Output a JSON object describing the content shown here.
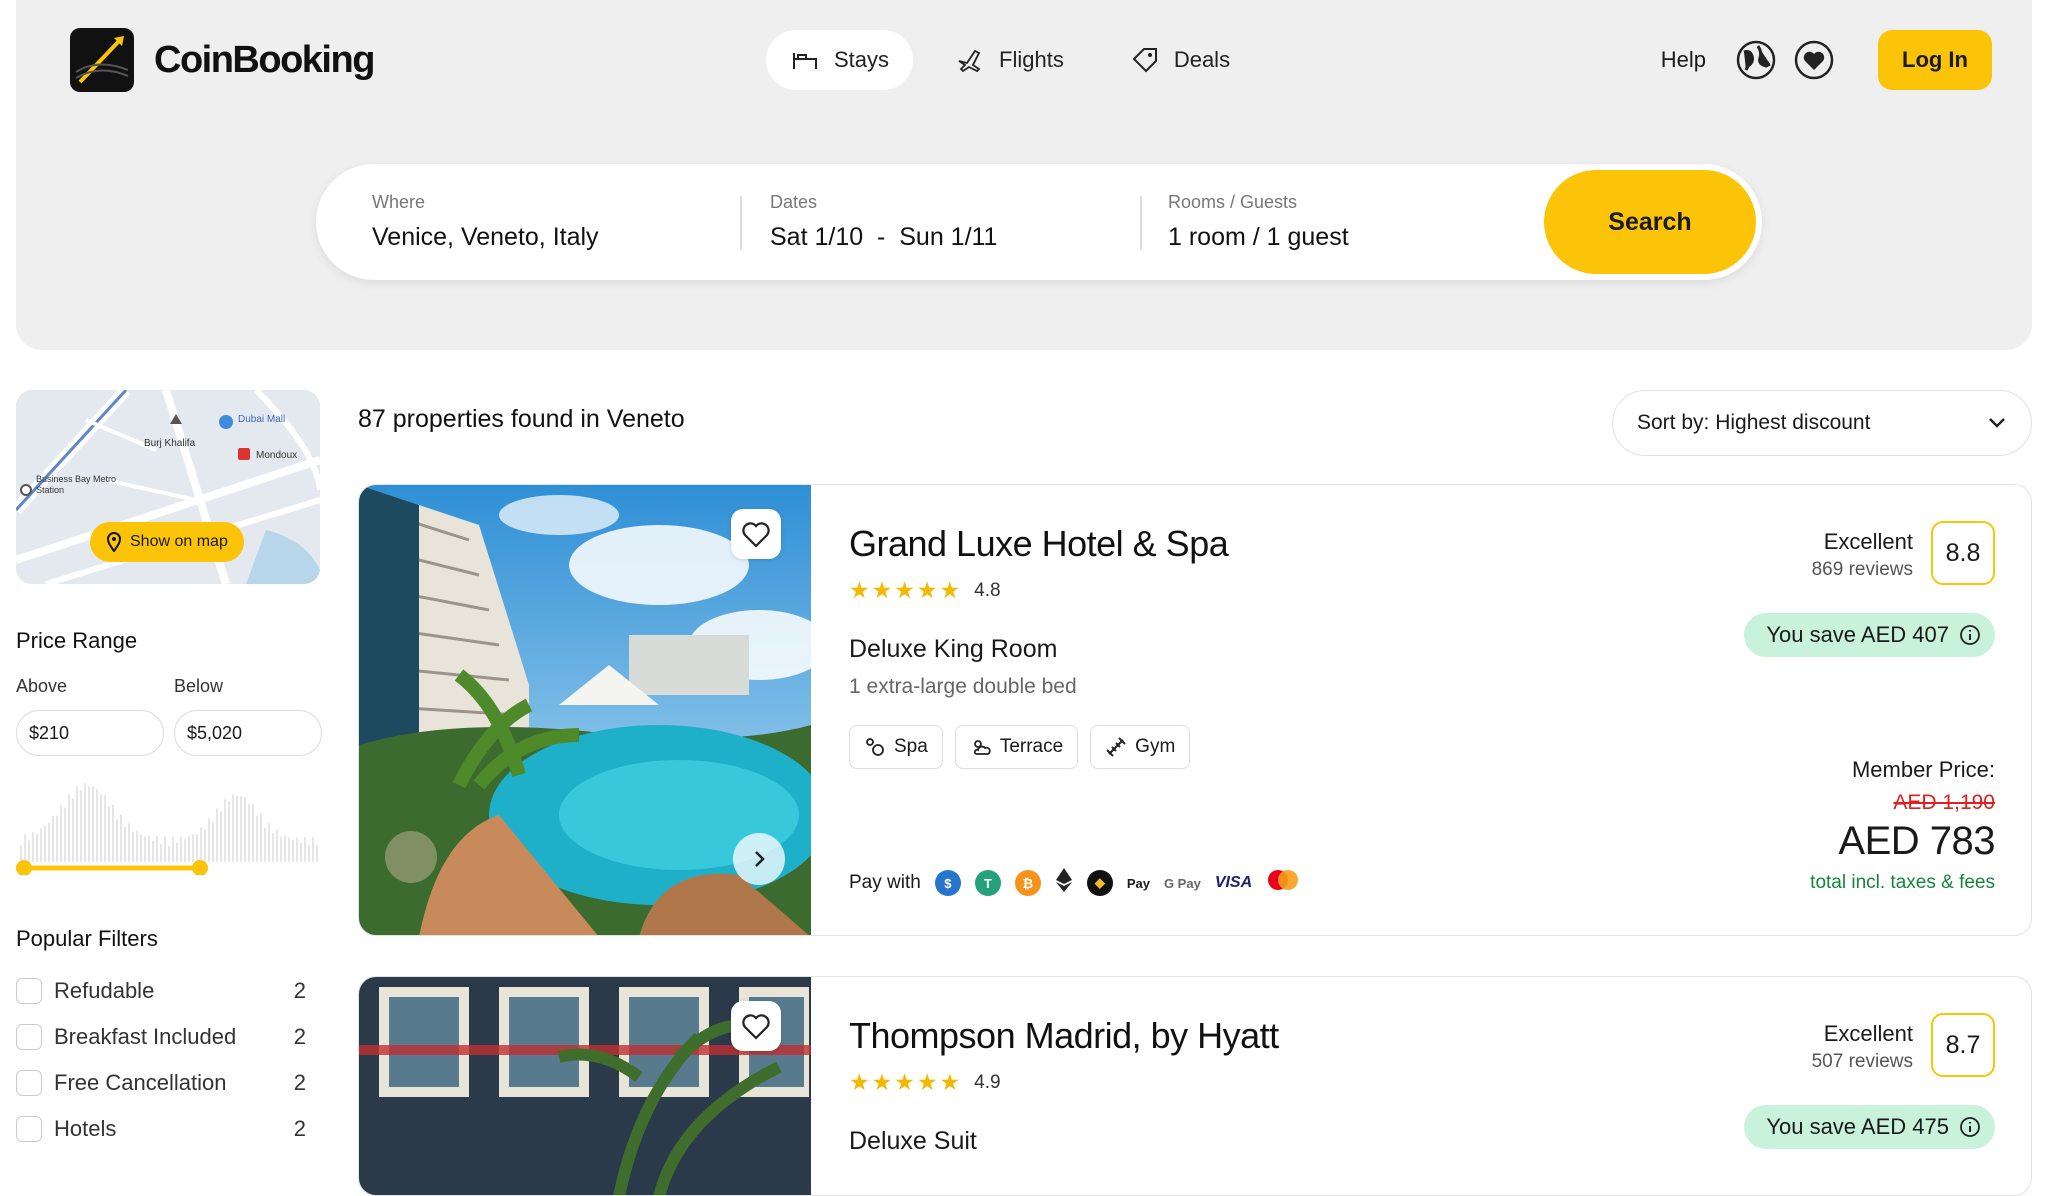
{
  "brand": {
    "name": "CoinBooking"
  },
  "nav": {
    "stays": "Stays",
    "flights": "Flights",
    "deals": "Deals"
  },
  "right_nav": {
    "help": "Help",
    "login": "Log In"
  },
  "search": {
    "where_label": "Where",
    "where_value": "Venice, Veneto, Italy",
    "dates_label": "Dates",
    "dates_value": "Sat 1/10  -  Sun 1/11",
    "guests_label": "Rooms / Guests",
    "guests_value": "1 room / 1 guest",
    "button": "Search"
  },
  "map": {
    "button": "Show on map",
    "labels": [
      "Burj Khalifa",
      "Dubai Mall",
      "Mondoux",
      "Business Bay Metro Station"
    ]
  },
  "price_range": {
    "title": "Price Range",
    "above_label": "Above",
    "below_label": "Below",
    "min": "$210",
    "max": "$5,020"
  },
  "popular_filters": {
    "title": "Popular Filters",
    "items": [
      {
        "label": "Refudable",
        "count": "2"
      },
      {
        "label": "Breakfast Included",
        "count": "2"
      },
      {
        "label": "Free Cancellation",
        "count": "2"
      },
      {
        "label": "Hotels",
        "count": "2"
      }
    ]
  },
  "results": {
    "count_text": "87 properties found in Veneto",
    "sort": "Sort by: Highest discount"
  },
  "hotels": [
    {
      "name": "Grand Luxe Hotel & Spa",
      "stars": "4.8",
      "star_fill": 4.8,
      "room": "Deluxe King Room",
      "bed": "1 extra-large double bed",
      "amenities": [
        "Spa",
        "Terrace",
        "Gym"
      ],
      "pay_with": "Pay with",
      "pay_methods": [
        "usdc-icon",
        "tether-icon",
        "bitcoin-icon",
        "ethereum-icon",
        "bnb-icon",
        "Pay",
        "G Pay",
        "VISA",
        "mastercard-icon"
      ],
      "rating_word": "Excellent",
      "reviews": "869 reviews",
      "score": "8.8",
      "save": "You save AED 407",
      "member_label": "Member Price:",
      "old_price": "AED 1,190",
      "new_price": "AED 783",
      "total_note": "total incl. taxes & fees"
    },
    {
      "name": "Thompson Madrid, by Hyatt",
      "stars": "4.9",
      "star_fill": 4.9,
      "room": "Deluxe Suit",
      "rating_word": "Excellent",
      "reviews": "507 reviews",
      "score": "8.7",
      "save": "You save AED 475"
    }
  ],
  "colors": {
    "accent": "#fcc409",
    "save_bg": "#c8f2d9",
    "price_green": "#16853a",
    "strike_red": "#e02020"
  }
}
